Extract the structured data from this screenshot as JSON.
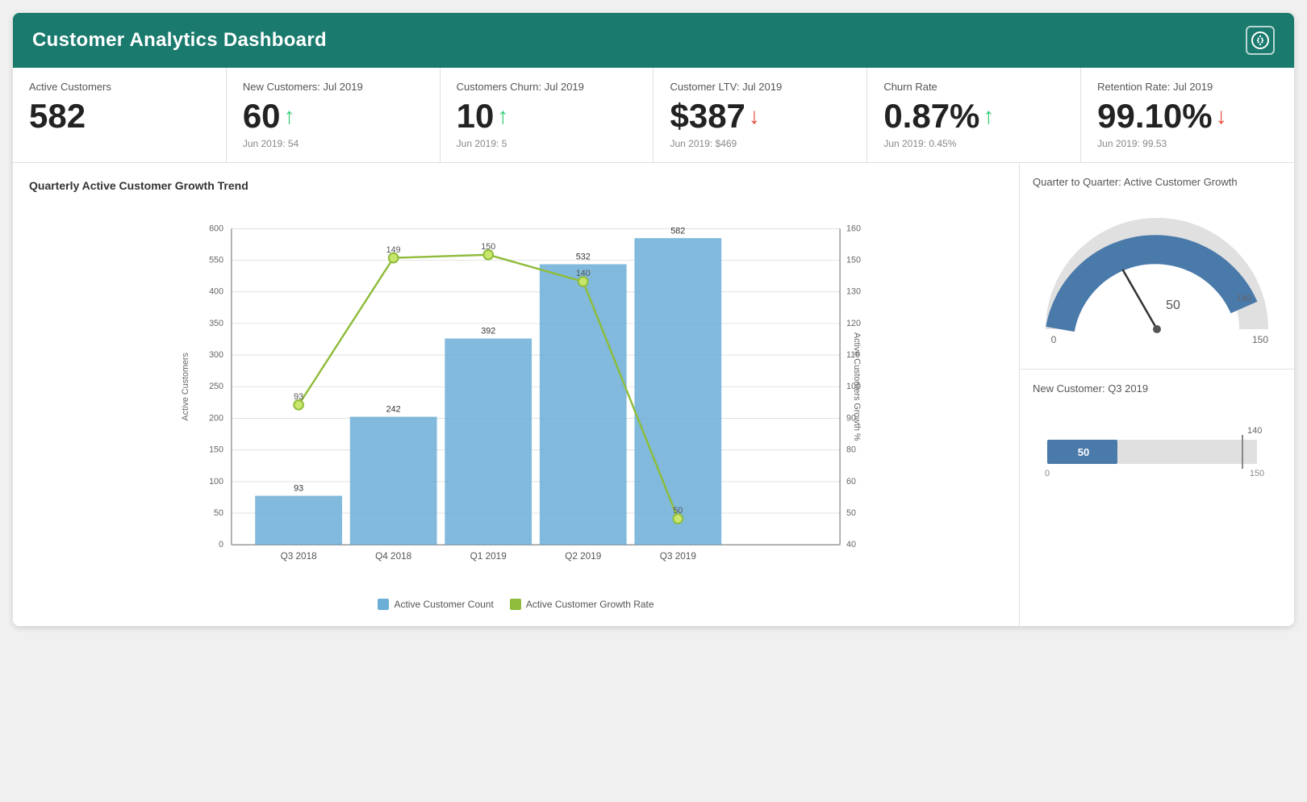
{
  "header": {
    "title": "Customer Analytics Dashboard",
    "icon": "$"
  },
  "kpis": [
    {
      "label": "Active Customers",
      "value": "582",
      "arrow": null,
      "sub": null
    },
    {
      "label": "New Customers: Jul 2019",
      "value": "60",
      "arrow": "up",
      "sub": "Jun 2019: 54"
    },
    {
      "label": "Customers Churn: Jul 2019",
      "value": "10",
      "arrow": "up",
      "sub": "Jun 2019: 5"
    },
    {
      "label": "Customer LTV: Jul 2019",
      "value": "$387",
      "arrow": "down",
      "sub": "Jun 2019: $469"
    },
    {
      "label": "Churn Rate",
      "value": "0.87%",
      "arrow": "up",
      "sub": "Jun 2019: 0.45%"
    },
    {
      "label": "Retention Rate: Jul 2019",
      "value": "99.10%",
      "arrow": "down",
      "sub": "Jun 2019: 99.53"
    }
  ],
  "main_chart": {
    "title": "Quarterly Active Customer Growth Trend",
    "bars": [
      {
        "label": "Q3 2018",
        "count": 93,
        "growth": 93
      },
      {
        "label": "Q4 2018",
        "count": 242,
        "growth": 149
      },
      {
        "label": "Q1 2019",
        "count": 392,
        "growth": 150
      },
      {
        "label": "Q2 2019",
        "count": 532,
        "growth": 140
      },
      {
        "label": "Q3 2019",
        "count": 582,
        "growth": 50
      }
    ],
    "legend": {
      "bar_label": "Active Customer Count",
      "line_label": "Active Customer Growth Rate"
    },
    "y_left_label": "Active Customers",
    "y_right_label": "Active Customers Growth %"
  },
  "gauge": {
    "title": "Quarter to Quarter: Active Customer Growth",
    "value": 50,
    "min": 0,
    "max": 150,
    "target": 140
  },
  "new_customer_bar": {
    "title": "New Customer: Q3 2019",
    "value": 50,
    "target": 140,
    "max": 150,
    "min": 0
  },
  "colors": {
    "teal": "#1a7a6e",
    "bar_blue": "#6baed6",
    "line_green": "#8fbc3b",
    "gauge_blue": "#4a7aaa",
    "arrow_up": "#2ecc71",
    "arrow_down": "#e74c3c"
  }
}
